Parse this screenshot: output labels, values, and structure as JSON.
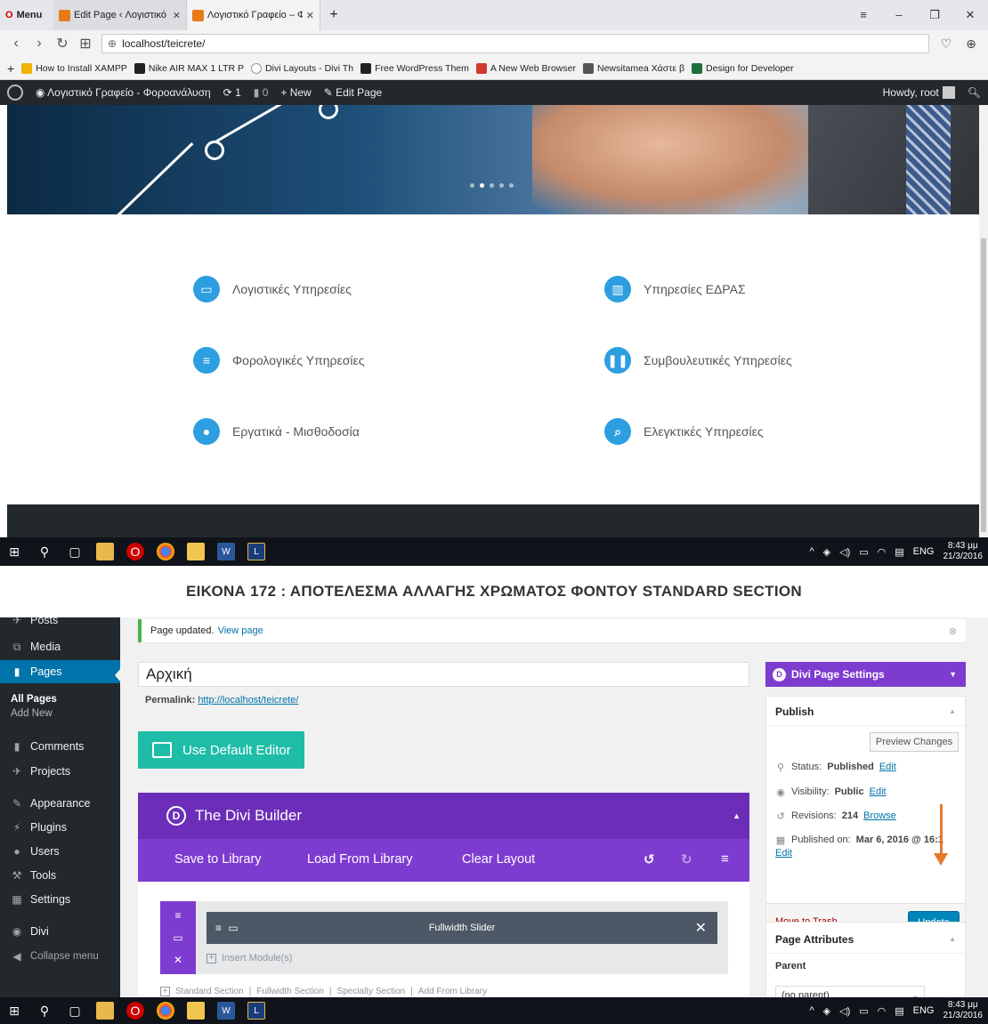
{
  "browser": {
    "menu_label": "Menu",
    "tabs": [
      {
        "title": "Edit Page ‹ Λογιστικό Γραφ"
      },
      {
        "title": "Λογιστικό Γραφείο – Φορο"
      }
    ],
    "address": "localhost/teicrete/",
    "bookmarks": [
      {
        "label": "How to Install XAMPP",
        "icon": "xampp-icon",
        "color": "#f0b400"
      },
      {
        "label": "Nike AIR MAX 1 LTR P",
        "icon": "tab-icon",
        "color": "#222222"
      },
      {
        "label": "Divi Layouts - Divi Th",
        "icon": "divi-icon",
        "color": "#9a9a9a"
      },
      {
        "label": "Free WordPress Them",
        "icon": "doc-icon",
        "color": "#222222"
      },
      {
        "label": "A New Web Browser",
        "icon": "vivaldi-icon",
        "color": "#d23a2e"
      },
      {
        "label": "Newsitamea Χάστε β",
        "icon": "house-icon",
        "color": "#555555"
      },
      {
        "label": "Design for Developer",
        "icon": "design-icon",
        "color": "#1e6f3a"
      }
    ]
  },
  "adminbar": {
    "site_name": "Λογιστικό Γραφείο - Φοροανάλυση",
    "updates_count": "1",
    "comments_count": "0",
    "new_label": "New",
    "edit_page_label": "Edit Page",
    "howdy": "Howdy, root"
  },
  "services": [
    {
      "label": "Λογιστικές Υπηρεσίες",
      "icon": "presentation-icon"
    },
    {
      "label": "Υπηρεσίες ΕΔΡΑΣ",
      "icon": "buildings-icon"
    },
    {
      "label": "Φορολογικές Υπηρεσίες",
      "icon": "document-icon"
    },
    {
      "label": "Συμβουλευτικές Υπηρεσίες",
      "icon": "people-icon"
    },
    {
      "label": "Εργατικά - Μισθοδοσία",
      "icon": "users-icon"
    },
    {
      "label": "Ελεγκτικές Υπηρεσίες",
      "icon": "audit-icon"
    }
  ],
  "taskbar": {
    "lang": "ENG",
    "time": "8:43 μμ",
    "date": "21/3/2016"
  },
  "caption": "ΕΙΚΟΝΑ 172 : ΑΠΟΤΕΛΕΣΜΑ ΑΛΛΑΓΗΣ ΧΡΩΜΑΤΟΣ ΦΟΝΤΟΥ STANDARD SECTION",
  "sidebar": {
    "items": [
      {
        "label": "Posts",
        "icon": "pin-icon"
      },
      {
        "label": "Media",
        "icon": "media-icon"
      },
      {
        "label": "Pages",
        "icon": "page-icon"
      },
      {
        "label": "Comments",
        "icon": "comment-icon"
      },
      {
        "label": "Projects",
        "icon": "pin-icon"
      },
      {
        "label": "Appearance",
        "icon": "brush-icon"
      },
      {
        "label": "Plugins",
        "icon": "plugin-icon"
      },
      {
        "label": "Users",
        "icon": "user-icon"
      },
      {
        "label": "Tools",
        "icon": "wrench-icon"
      },
      {
        "label": "Settings",
        "icon": "settings-icon"
      },
      {
        "label": "Divi",
        "icon": "divi-icon"
      },
      {
        "label": "Collapse menu",
        "icon": "collapse-icon"
      }
    ],
    "pages_sub": [
      "All Pages",
      "Add New"
    ]
  },
  "notice": {
    "text": "Page updated.",
    "link": "View page"
  },
  "editor": {
    "title": "Αρχική",
    "permalink_label": "Permalink:",
    "permalink_url": "http://localhost/teicrete/",
    "default_editor": "Use Default Editor"
  },
  "divi": {
    "title": "The Divi Builder",
    "save_library": "Save to Library",
    "load_library": "Load From Library",
    "clear_layout": "Clear Layout",
    "module_title": "Fullwidth Slider",
    "insert_module": "Insert Module(s)",
    "add_links": [
      "Standard Section",
      "Fullwidth Section",
      "Specialty Section",
      "Add From Library"
    ]
  },
  "page_settings": "Divi Page Settings",
  "publish": {
    "heading": "Publish",
    "preview": "Preview Changes",
    "status_label": "Status:",
    "status_value": "Published",
    "visibility_label": "Visibility:",
    "visibility_value": "Public",
    "revisions_label": "Revisions:",
    "revisions_value": "214",
    "browse": "Browse",
    "published_on_label": "Published on:",
    "published_on_value": "Mar 6, 2016 @ 16:1",
    "edit": "Edit",
    "trash": "Move to Trash",
    "update": "Update"
  },
  "attributes": {
    "heading": "Page Attributes",
    "parent_label": "Parent",
    "parent_value": "(no parent)"
  }
}
